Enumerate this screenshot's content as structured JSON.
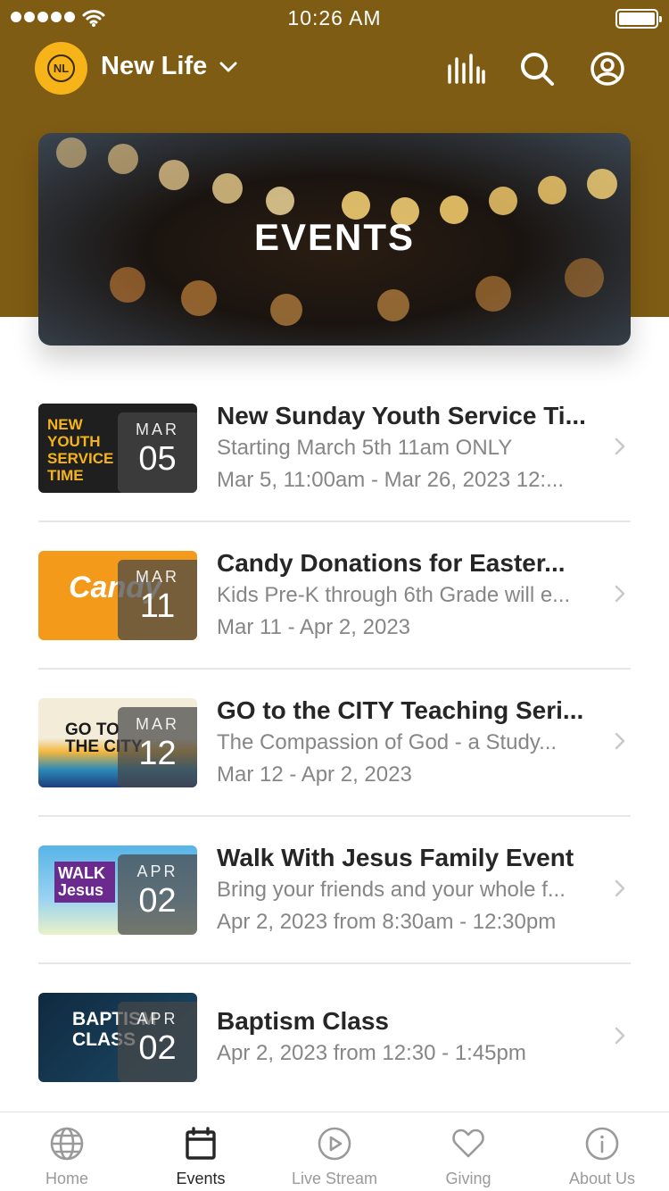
{
  "status_bar": {
    "time": "10:26 AM"
  },
  "header": {
    "org_name": "New Life",
    "logo_text": "NL"
  },
  "icons": {
    "org_dropdown": "chevron-down-icon",
    "audio": "equalizer-icon",
    "search": "search-icon",
    "profile": "account-icon",
    "row_chevron": "chevron-right-icon"
  },
  "colors": {
    "header_background": "#7f5c14",
    "logo_background": "#f6b419",
    "title_text": "#262626",
    "secondary_text": "#868686",
    "tab_inactive": "#9a9a9a"
  },
  "hero": {
    "title": "EVENTS"
  },
  "events": [
    {
      "title": "New Sunday Youth Service Ti...",
      "line1": "Starting March 5th 11am ONLY",
      "line2": "Mar 5, 11:00am - Mar 26, 2023 12:...",
      "month": "MAR",
      "day": "05",
      "thumb_text": "NEW YOUTH SERVICE TIME"
    },
    {
      "title": "Candy Donations for Easter...",
      "line1": "Kids Pre-K through 6th Grade will e...",
      "line2": "Mar 11 - Apr 2, 2023",
      "month": "MAR",
      "day": "11",
      "thumb_text": "Candy"
    },
    {
      "title": "GO to the CITY Teaching Seri...",
      "line1": "The Compassion of God - a Study...",
      "line2": "Mar 12 - Apr 2, 2023",
      "month": "MAR",
      "day": "12",
      "thumb_text": "GO TO THE CITY"
    },
    {
      "title": "Walk With Jesus Family Event",
      "line1": "Bring your friends and your whole f...",
      "line2": "Apr 2, 2023 from 8:30am - 12:30pm",
      "month": "APR",
      "day": "02",
      "thumb_text": "WALK Jesus"
    },
    {
      "title": "Baptism Class",
      "line1": "Apr 2, 2023 from 12:30 - 1:45pm",
      "line2": "",
      "month": "APR",
      "day": "02",
      "thumb_text": "BAPTISM CLASS"
    }
  ],
  "tabs": [
    {
      "label": "Home",
      "icon": "globe-icon",
      "active": false
    },
    {
      "label": "Events",
      "icon": "calendar-icon",
      "active": true
    },
    {
      "label": "Live Stream",
      "icon": "play-circle-icon",
      "active": false
    },
    {
      "label": "Giving",
      "icon": "heart-icon",
      "active": false
    },
    {
      "label": "About Us",
      "icon": "info-circle-icon",
      "active": false
    }
  ]
}
